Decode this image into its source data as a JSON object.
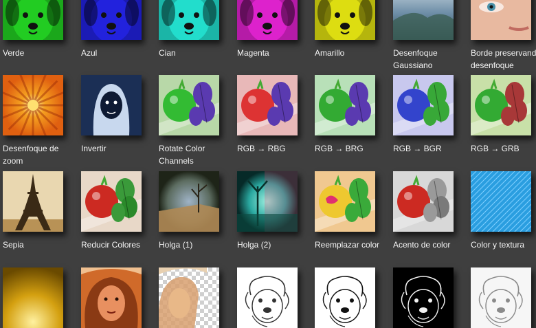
{
  "gallery": {
    "rows": [
      [
        {
          "label": "Verde",
          "icon": "dog-green-icon",
          "color": "#22cc22"
        },
        {
          "label": "Azul",
          "icon": "dog-blue-icon",
          "color": "#2222dd"
        },
        {
          "label": "Cian",
          "icon": "dog-cyan-icon",
          "color": "#22ddcc"
        },
        {
          "label": "Magenta",
          "icon": "dog-magenta-icon",
          "color": "#dd22cc"
        },
        {
          "label": "Amarillo",
          "icon": "dog-yellow-icon",
          "color": "#dddd11"
        },
        {
          "label": "Desenfoque Gaussiano",
          "icon": "blurred-landscape-icon",
          "color": "#6f8fa8"
        },
        {
          "label": "Borde preservando desenfoque",
          "icon": "face-closeup-icon",
          "color": "#e8b9a0"
        }
      ],
      [
        {
          "label": "Desenfoque de zoom",
          "icon": "zoom-blur-flower-icon",
          "color": "#e06010"
        },
        {
          "label": "Invertir",
          "icon": "inverted-portrait-icon",
          "color": "#1b2f55"
        },
        {
          "label": "Rotate Color Channels",
          "icon": "tomato-rotate-icon",
          "color": "#33bb33"
        },
        {
          "label": "RGB → RBG",
          "icon": "tomato-rbg-icon",
          "color": "#dd3333"
        },
        {
          "label": "RGB → BRG",
          "icon": "tomato-brg-icon",
          "color": "#33aa33"
        },
        {
          "label": "RGB → BGR",
          "icon": "tomato-bgr-icon",
          "color": "#3344cc"
        },
        {
          "label": "RGB → GRB",
          "icon": "tomato-grb-icon",
          "color": "#33aa33"
        }
      ],
      [
        {
          "label": "Sepia",
          "icon": "eiffel-tower-icon",
          "color": "#b89256"
        },
        {
          "label": "Reducir Colores",
          "icon": "tomato-reduced-icon",
          "color": "#cc2a22"
        },
        {
          "label": "Holga (1)",
          "icon": "holga-landscape-icon",
          "color": "#b08a55"
        },
        {
          "label": "Holga (2)",
          "icon": "holga-teal-icon",
          "color": "#2aa8a0"
        },
        {
          "label": "Reemplazar color",
          "icon": "tomato-replaced-icon",
          "color": "#eec830"
        },
        {
          "label": "Acento de color",
          "icon": "tomato-accent-icon",
          "color": "#cc2a22"
        },
        {
          "label": "Color y textura",
          "icon": "blue-texture-icon",
          "color": "#2a9ee0"
        }
      ],
      [
        {
          "label": "",
          "icon": "gold-gradient-icon",
          "color": "#d4a010"
        },
        {
          "label": "",
          "icon": "portrait-orange-icon",
          "color": "#d06a2a"
        },
        {
          "label": "",
          "icon": "portrait-transparent-icon",
          "color": "#d8a070"
        },
        {
          "label": "",
          "icon": "dog-sketch-icon",
          "color": "#ffffff"
        },
        {
          "label": "",
          "icon": "dog-sketch-dark-icon",
          "color": "#ffffff"
        },
        {
          "label": "",
          "icon": "dog-edges-icon",
          "color": "#000000"
        },
        {
          "label": "",
          "icon": "dog-sketch-light-icon",
          "color": "#f6f6f6"
        }
      ]
    ]
  }
}
